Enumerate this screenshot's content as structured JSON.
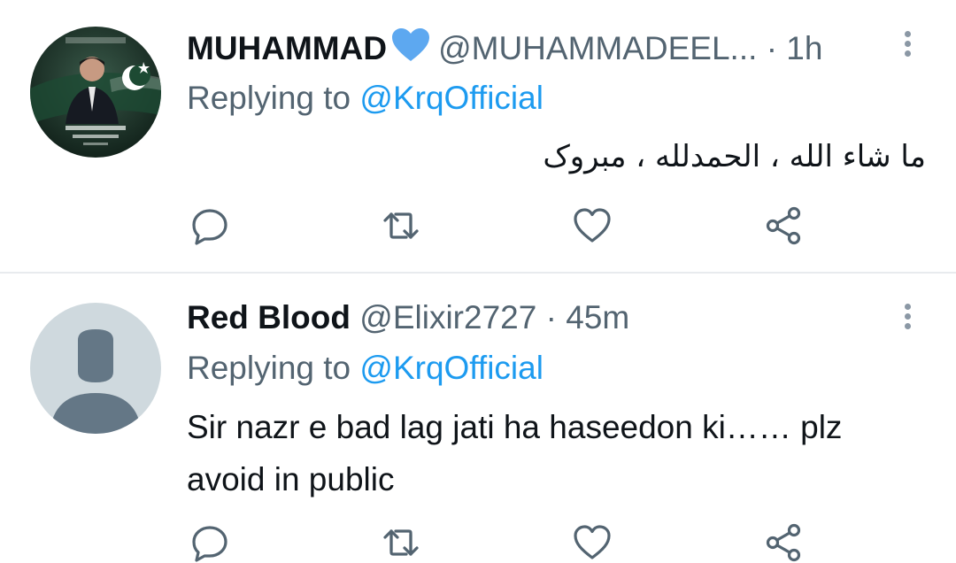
{
  "tweets": [
    {
      "name": "MUHAMMAD",
      "verified_emoji": "blue-heart",
      "handle": "@MUHAMMADEEL...",
      "separator": "·",
      "time": "1h",
      "replying_prefix": "Replying to",
      "replying_to": "@KrqOfficial",
      "text": "ما شاء الله ، الحمدلله ، مبروک",
      "avatar": "profile-photo-flag"
    },
    {
      "name": "Red Blood",
      "handle": "@Elixir2727",
      "separator": "·",
      "time": "45m",
      "replying_prefix": "Replying to",
      "replying_to": "@KrqOfficial",
      "text": "Sir nazr e bad lag jati ha haseedon ki…… plz avoid in public",
      "avatar": "default-avatar"
    }
  ],
  "actions": [
    "reply-icon",
    "retweet-icon",
    "like-icon",
    "share-icon"
  ],
  "colors": {
    "text": "#0f1419",
    "secondary": "#536471",
    "link": "#1d9bf0",
    "heart": "#5da8f0",
    "divider": "#e8ebee",
    "default_avatar_bg": "#cfd9de",
    "default_avatar_fg": "#647786"
  }
}
